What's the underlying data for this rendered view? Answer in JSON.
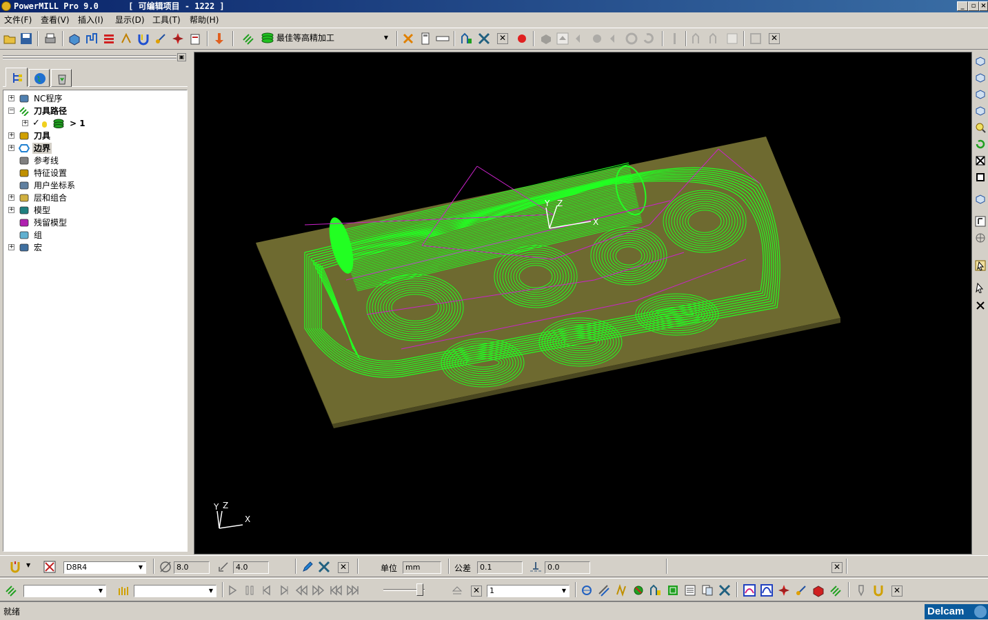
{
  "window": {
    "title": "PowerMILL Pro 9.0      [ 可编辑项目 - 1222 ]",
    "minimize": "_",
    "restore": "▫",
    "close": "×"
  },
  "menu": {
    "items": [
      "文件(F)",
      "查看(V)",
      "插入(I)",
      "显示(D)",
      "工具(T)",
      "帮助(H)"
    ]
  },
  "main_toolbar": {
    "strategy_label": "最佳等高精加工"
  },
  "explorer": {
    "tabs": [
      "explorer-tab-icon",
      "globe-icon",
      "recycle-bin-icon"
    ],
    "items": [
      {
        "label": "NC程序",
        "icon": "nc-program-icon",
        "expandable": true,
        "bold": false
      },
      {
        "label": "刀具路径",
        "icon": "toolpath-icon",
        "expandable": true,
        "expanded": true,
        "bold": true
      },
      {
        "label": "> 1",
        "icon": "toolpath-item-icon",
        "expandable": true,
        "bold": true,
        "child": true
      },
      {
        "label": "刀具",
        "icon": "tool-icon",
        "expandable": true,
        "bold": true
      },
      {
        "label": "边界",
        "icon": "boundary-icon",
        "expandable": true,
        "bold": true,
        "selected": true
      },
      {
        "label": "参考线",
        "icon": "pattern-icon",
        "expandable": false
      },
      {
        "label": "特征设置",
        "icon": "feature-icon",
        "expandable": false
      },
      {
        "label": "用户坐标系",
        "icon": "workplane-icon",
        "expandable": false
      },
      {
        "label": "层和组合",
        "icon": "layers-icon",
        "expandable": true
      },
      {
        "label": "模型",
        "icon": "model-icon",
        "expandable": true
      },
      {
        "label": "残留模型",
        "icon": "stock-model-icon",
        "expandable": false
      },
      {
        "label": "组",
        "icon": "group-icon",
        "expandable": false
      },
      {
        "label": "宏",
        "icon": "macro-icon",
        "expandable": true
      }
    ]
  },
  "viewport": {
    "axis_main": {
      "x": "X",
      "y": "Y",
      "z": "Z"
    },
    "axis_corner": {
      "x": "X",
      "y": "Y",
      "z": "Z"
    },
    "colors": {
      "background": "#000000",
      "toolpath": "#22ff22",
      "links": "#cc22cc",
      "stock": "#6e6a30",
      "stock_dark": "#4a4720"
    }
  },
  "tool_toolbar": {
    "tool_name": "D8R4",
    "diameter": "8.0",
    "tip_radius": "4.0",
    "units_label": "单位",
    "units_value": "mm",
    "tolerance_label": "公差",
    "tolerance_value": "0.1",
    "thickness_value": "0.0"
  },
  "sim_toolbar": {
    "toolpath_combo": "",
    "tool_combo": "",
    "step_value": "1"
  },
  "status": {
    "text": "就绪",
    "brand": "Delcam"
  }
}
